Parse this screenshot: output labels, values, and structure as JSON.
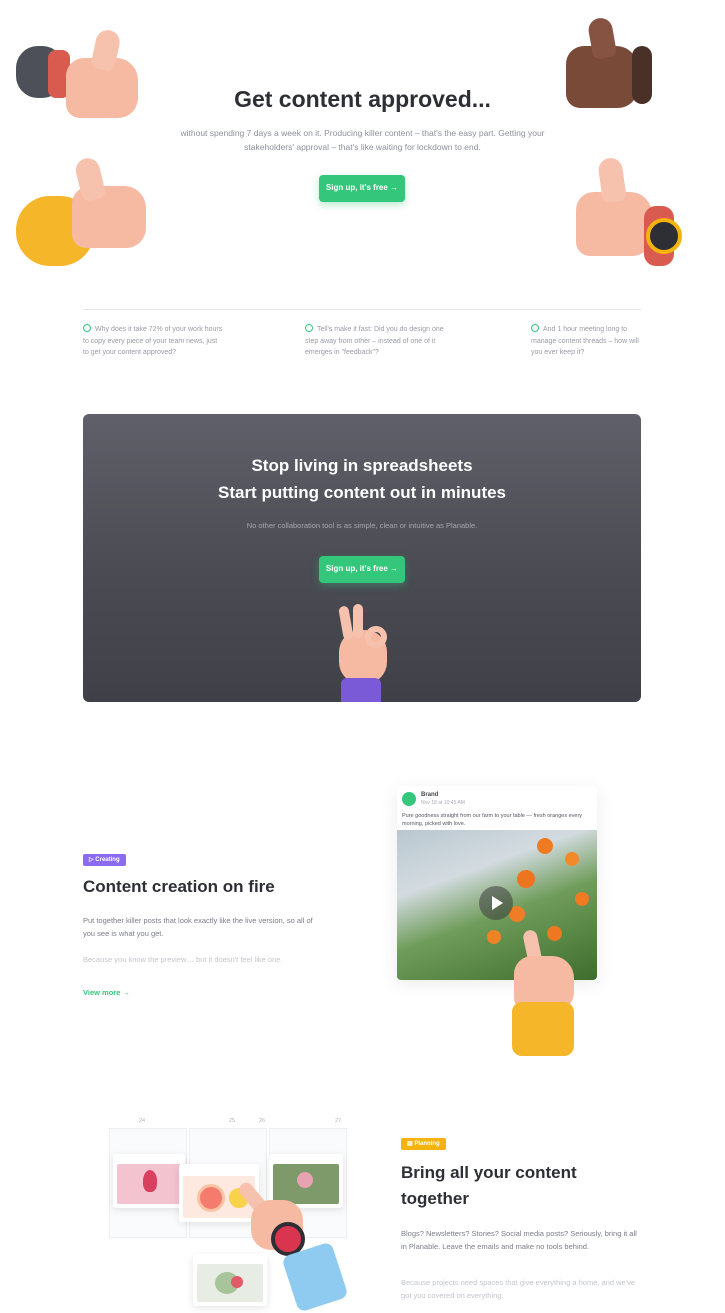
{
  "hero": {
    "title": "Get content approved...",
    "subtitle": "without spending 7 days a week on it. Producing killer content – that's the easy part. Getting your stakeholders' approval – that's like waiting for lockdown to end.",
    "cta_label": "Sign up, it's free →"
  },
  "faqs": [
    {
      "text": "Why does it take 72% of your work hours to copy every piece of your team news, just to get your content approved?"
    },
    {
      "text": "Tell's make it fast: Did you do design one step away from other – instead of one of it emerges in \"feedback\"?"
    },
    {
      "text": "And 1 hour meeting long to manage content threads – how will you ever keep it?"
    }
  ],
  "cta_section": {
    "line1": "Stop living in spreadsheets",
    "line2": "Start putting content out in minutes",
    "subtitle": "No other collaboration tool is as simple, clean or intuitive as Planable.",
    "button_label": "Sign up, it's free →"
  },
  "feature1": {
    "badge": "▷ Creating",
    "title": "Content creation on fire",
    "p1": "Put together killer posts that look exactly like the live version, so all of you see is what you get.",
    "p2": "Because you know the preview… but it doesn't feel like one.",
    "link": "View more →",
    "post": {
      "name": "Brand",
      "date": "Nov 18 at 10:45 AM",
      "text": "Pure goodness straight from our farm to your table — fresh oranges every morning, picked with love."
    }
  },
  "feature2": {
    "badge": "▤ Planning",
    "title": "Bring all your content together",
    "p1": "Blogs? Newsletters? Stories? Social media posts? Seriously, bring it all in Planable. Leave the emails and make no tools behind.",
    "p2": "Because projects need spaces that give everything a home, and we've got you covered on everything.",
    "calendar_days": [
      "24",
      "25",
      "26",
      "27"
    ]
  },
  "colors": {
    "accent_green": "#34c77b",
    "badge_purple": "#8b6cf0",
    "badge_yellow": "#f5b30f",
    "cta_dark": "#4a4b53"
  }
}
